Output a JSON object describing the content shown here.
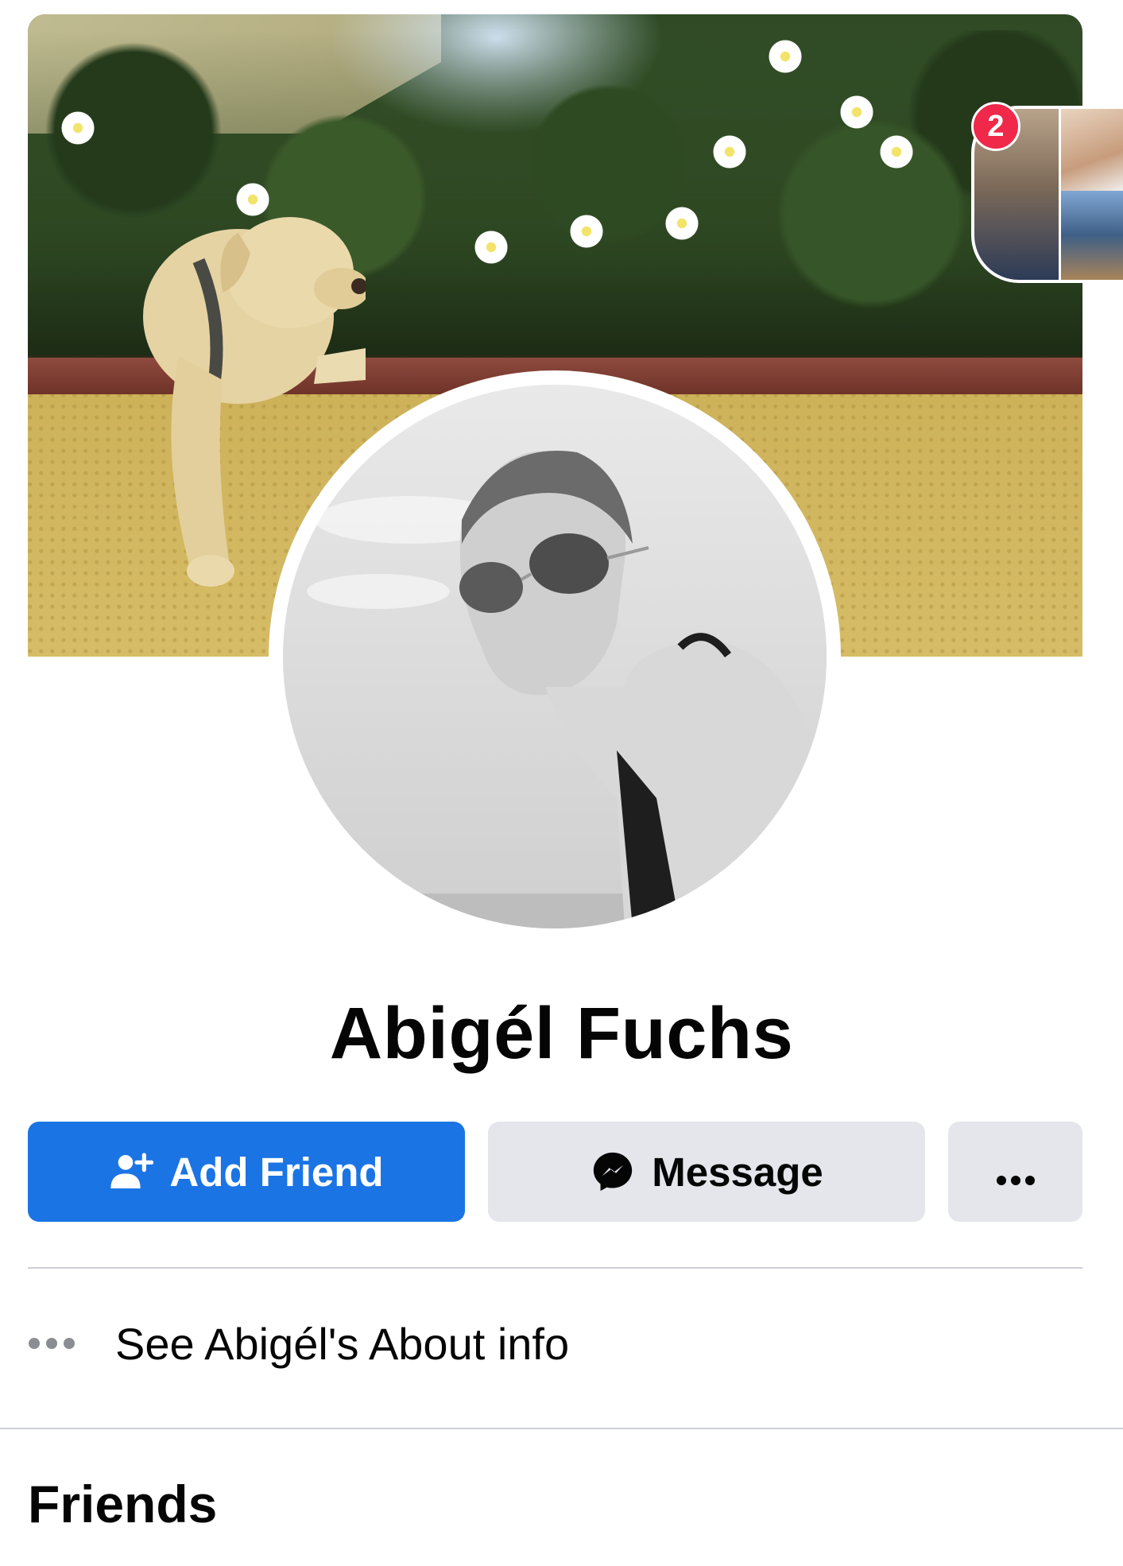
{
  "profile": {
    "name": "Abigél Fuchs",
    "story_badge_count": "2"
  },
  "actions": {
    "add_friend_label": "Add Friend",
    "message_label": "Message",
    "more_icon": "more-dots-icon"
  },
  "about": {
    "label": "See Abigél's About info",
    "icon": "more-dots-icon"
  },
  "sections": {
    "friends_title": "Friends"
  },
  "colors": {
    "primary": "#1b74e4",
    "secondary_button": "#e4e6eb",
    "badge": "#f02849",
    "divider": "#ced0d4"
  }
}
